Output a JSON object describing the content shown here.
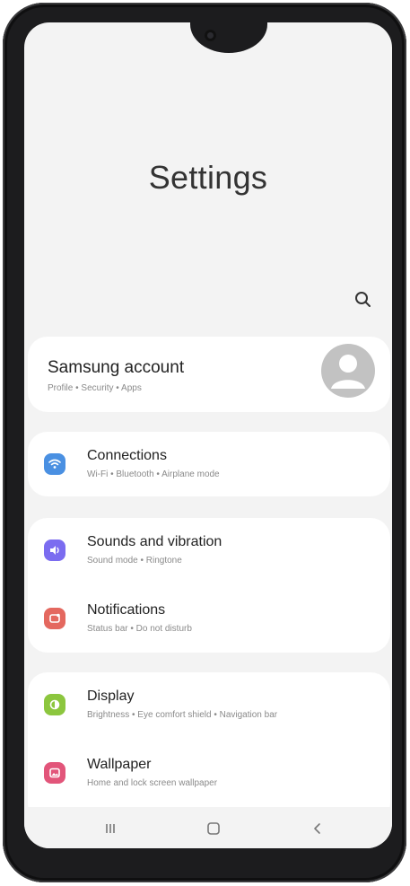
{
  "page": {
    "title": "Settings"
  },
  "search": {
    "icon": "search-icon"
  },
  "account": {
    "title": "Samsung account",
    "subtitle": "Profile • Security • Apps",
    "avatar_icon": "person-icon"
  },
  "settings_groups": [
    {
      "items": [
        {
          "title": "Connections",
          "subtitle": "Wi-Fi • Bluetooth • Airplane mode",
          "icon": "wifi-icon",
          "color": "#4a90e2"
        }
      ]
    },
    {
      "items": [
        {
          "title": "Sounds and vibration",
          "subtitle": "Sound mode • Ringtone",
          "icon": "speaker-icon",
          "color": "#7b6cf0"
        },
        {
          "title": "Notifications",
          "subtitle": "Status bar • Do not disturb",
          "icon": "notification-icon",
          "color": "#e4685f"
        }
      ]
    },
    {
      "items": [
        {
          "title": "Display",
          "subtitle": "Brightness • Eye comfort shield • Navigation bar",
          "icon": "brightness-icon",
          "color": "#8cc63e"
        },
        {
          "title": "Wallpaper",
          "subtitle": "Home and lock screen wallpaper",
          "icon": "image-icon",
          "color": "#e2557a"
        }
      ]
    }
  ],
  "navbar": {
    "recent_icon": "recent-apps-icon",
    "home_icon": "home-icon",
    "back_icon": "back-icon"
  }
}
